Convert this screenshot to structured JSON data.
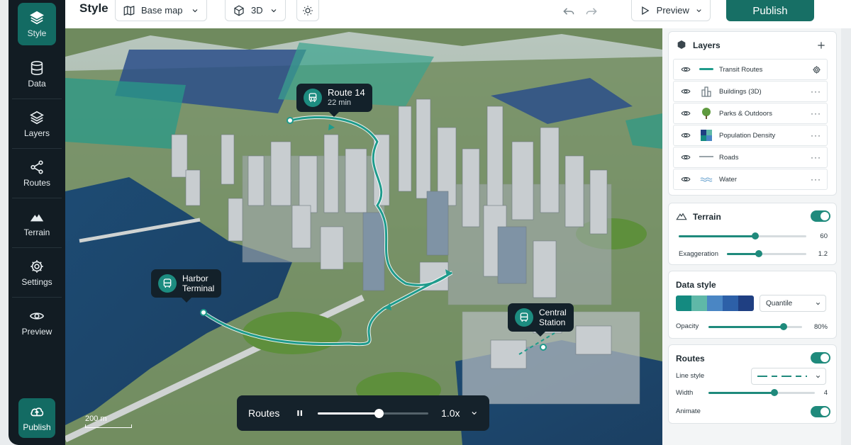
{
  "rail": {
    "items": [
      {
        "label": "Style",
        "icon": "stack-diamond-icon",
        "active": true
      },
      {
        "label": "Data",
        "icon": "database-icon"
      },
      {
        "label": "Layers",
        "icon": "layers-icon"
      },
      {
        "label": "Routes",
        "icon": "share-nodes-icon"
      },
      {
        "label": "Terrain",
        "icon": "mountain-icon"
      },
      {
        "label": "Settings",
        "icon": "gear-icon"
      },
      {
        "label": "Preview",
        "icon": "eye-icon"
      }
    ],
    "publish_label": "Publish"
  },
  "topbar": {
    "title": "Style",
    "basemap_label": "Base map",
    "view_label": "3D",
    "preview_label": "Preview",
    "publish_label": "Publish"
  },
  "map": {
    "callouts": {
      "route14": {
        "title": "Route 14",
        "sub": "22 min"
      },
      "harbor": {
        "line1": "Harbor",
        "line2": "Terminal"
      },
      "central": {
        "line1": "Central",
        "line2": "Station"
      }
    },
    "scale_label": "200 m",
    "player": {
      "label": "Routes",
      "speed": "1.0x",
      "progress": 0.55
    }
  },
  "layers": {
    "title": "Layers",
    "items": [
      {
        "name": "Transit Routes",
        "action": "gear"
      },
      {
        "name": "Buildings (3D)",
        "action": "more"
      },
      {
        "name": "Parks & Outdoors",
        "action": "more"
      },
      {
        "name": "Population Density",
        "action": "more"
      },
      {
        "name": "Roads",
        "action": "more"
      },
      {
        "name": "Water",
        "action": "more"
      }
    ],
    "more_glyph": "···"
  },
  "terrain": {
    "title": "Terrain",
    "enabled": true,
    "slider1": {
      "value": "60",
      "fraction": 0.6
    },
    "exaggeration": {
      "label": "Exaggeration",
      "value": "1.2",
      "fraction": 0.4
    }
  },
  "data_style": {
    "title": "Data style",
    "palette": [
      "#148a80",
      "#5fb8a8",
      "#4a86c4",
      "#2d60a8",
      "#1f3f82"
    ],
    "classification": "Quantile",
    "opacity": {
      "label": "Opacity",
      "value": "80%",
      "fraction": 0.8
    }
  },
  "routes": {
    "title": "Routes",
    "enabled": true,
    "line_style_label": "Line style",
    "width": {
      "label": "Width",
      "value": "4",
      "fraction": 0.62
    },
    "animate": {
      "label": "Animate",
      "enabled": true
    }
  },
  "colors": {
    "accent": "#176f65",
    "dark": "#121c23",
    "route": "#1f9b8c"
  }
}
